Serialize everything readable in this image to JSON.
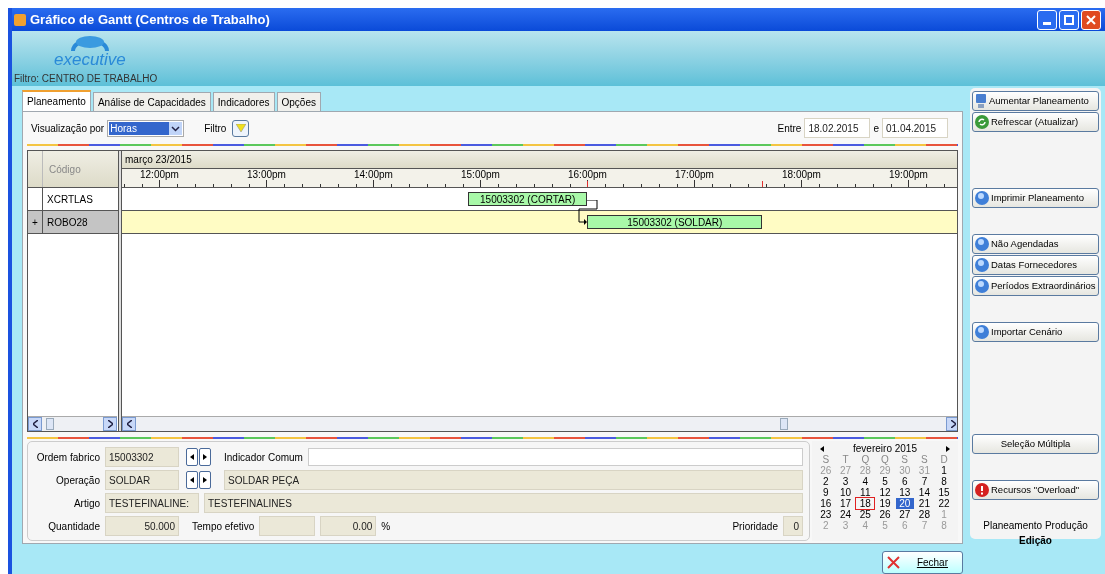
{
  "window": {
    "title": "Gráfico de Gantt (Centros de Trabalho)",
    "logo_text": "executive",
    "filter_label": "Filtro: CENTRO DE TRABALHO"
  },
  "tabs": [
    {
      "label": "Planeamento",
      "selected": true
    },
    {
      "label": "Análise de Capacidades",
      "selected": false
    },
    {
      "label": "Indicadores",
      "selected": false
    },
    {
      "label": "Opções",
      "selected": false
    }
  ],
  "toolbar": {
    "view_label": "Visualização por",
    "view_value": "Horas",
    "filter_label": "Filtro",
    "range_label": "Entre",
    "date_from": "18.02.2015",
    "range_sep": "e",
    "date_to": "01.04.2015"
  },
  "gantt": {
    "code_header": "Código",
    "date_header": "março 23/2015",
    "hours": [
      "12:00pm",
      "13:00pm",
      "14:00pm",
      "15:00pm",
      "16:00pm",
      "17:00pm",
      "18:00pm",
      "19:00pm"
    ],
    "rows": [
      {
        "expander": "",
        "code": "XCRTLAS",
        "selected": false,
        "bar": {
          "label": "15003302 (CORTAR)"
        }
      },
      {
        "expander": "+",
        "code": "ROBO28",
        "selected": true,
        "bar": {
          "label": "15003302 (SOLDAR)"
        }
      }
    ]
  },
  "details": {
    "order_label": "Ordem fabrico",
    "order": "15003302",
    "indicator_label": "Indicador Comum",
    "operation_label": "Operação",
    "operation": "SOLDAR",
    "operation_desc": "SOLDAR PEÇA",
    "article_label": "Artigo",
    "article": "TESTEFINALINE:",
    "article_desc": "TESTEFINALINES",
    "quantity_label": "Quantidade",
    "quantity": "50.000",
    "time_label": "Tempo efetivo",
    "percent": "0.00",
    "percent_sign": "%",
    "priority_label": "Prioridade",
    "priority": "0"
  },
  "calendar": {
    "month": "fevereiro 2015",
    "weekdays": [
      "S",
      "T",
      "Q",
      "Q",
      "S",
      "S",
      "D"
    ],
    "days": [
      {
        "d": "26",
        "muted": true
      },
      {
        "d": "27",
        "muted": true
      },
      {
        "d": "28",
        "muted": true
      },
      {
        "d": "29",
        "muted": true
      },
      {
        "d": "30",
        "muted": true
      },
      {
        "d": "31",
        "muted": true
      },
      {
        "d": "1"
      },
      {
        "d": "2"
      },
      {
        "d": "3"
      },
      {
        "d": "4"
      },
      {
        "d": "5"
      },
      {
        "d": "6"
      },
      {
        "d": "7"
      },
      {
        "d": "8"
      },
      {
        "d": "9"
      },
      {
        "d": "10"
      },
      {
        "d": "11"
      },
      {
        "d": "12"
      },
      {
        "d": "13"
      },
      {
        "d": "14"
      },
      {
        "d": "15"
      },
      {
        "d": "16"
      },
      {
        "d": "17"
      },
      {
        "d": "18",
        "today": true
      },
      {
        "d": "19"
      },
      {
        "d": "20",
        "selected": true
      },
      {
        "d": "21"
      },
      {
        "d": "22"
      },
      {
        "d": "23"
      },
      {
        "d": "24"
      },
      {
        "d": "25"
      },
      {
        "d": "26"
      },
      {
        "d": "27"
      },
      {
        "d": "28"
      },
      {
        "d": "1",
        "muted": true
      },
      {
        "d": "2",
        "muted": true
      },
      {
        "d": "3",
        "muted": true
      },
      {
        "d": "4",
        "muted": true
      },
      {
        "d": "5",
        "muted": true
      },
      {
        "d": "6",
        "muted": true
      },
      {
        "d": "7",
        "muted": true
      },
      {
        "d": "8",
        "muted": true
      }
    ]
  },
  "side_buttons": [
    [
      {
        "label": "Aumentar Planeamento",
        "kind": "monitor"
      },
      {
        "label": "Refrescar (Atualizar)",
        "kind": "refresh"
      }
    ],
    [
      {
        "label": "Imprimir Planeamento",
        "kind": "sphere"
      }
    ],
    [
      {
        "label": "Não Agendadas",
        "kind": "sphere"
      },
      {
        "label": "Datas Fornecedores",
        "kind": "sphere"
      },
      {
        "label": "Períodos Extraordinários",
        "kind": "sphere"
      }
    ],
    [
      {
        "label": "Importar Cenário",
        "kind": "sphere"
      }
    ],
    [
      {
        "label": "Seleção Múltipla",
        "kind": "plain"
      }
    ],
    [
      {
        "label": "Recursos \"Overload\"",
        "kind": "alert"
      }
    ]
  ],
  "side_footer": {
    "line1": "Planeamento Produção",
    "line2": "Edição"
  },
  "close_button": "Fechar"
}
